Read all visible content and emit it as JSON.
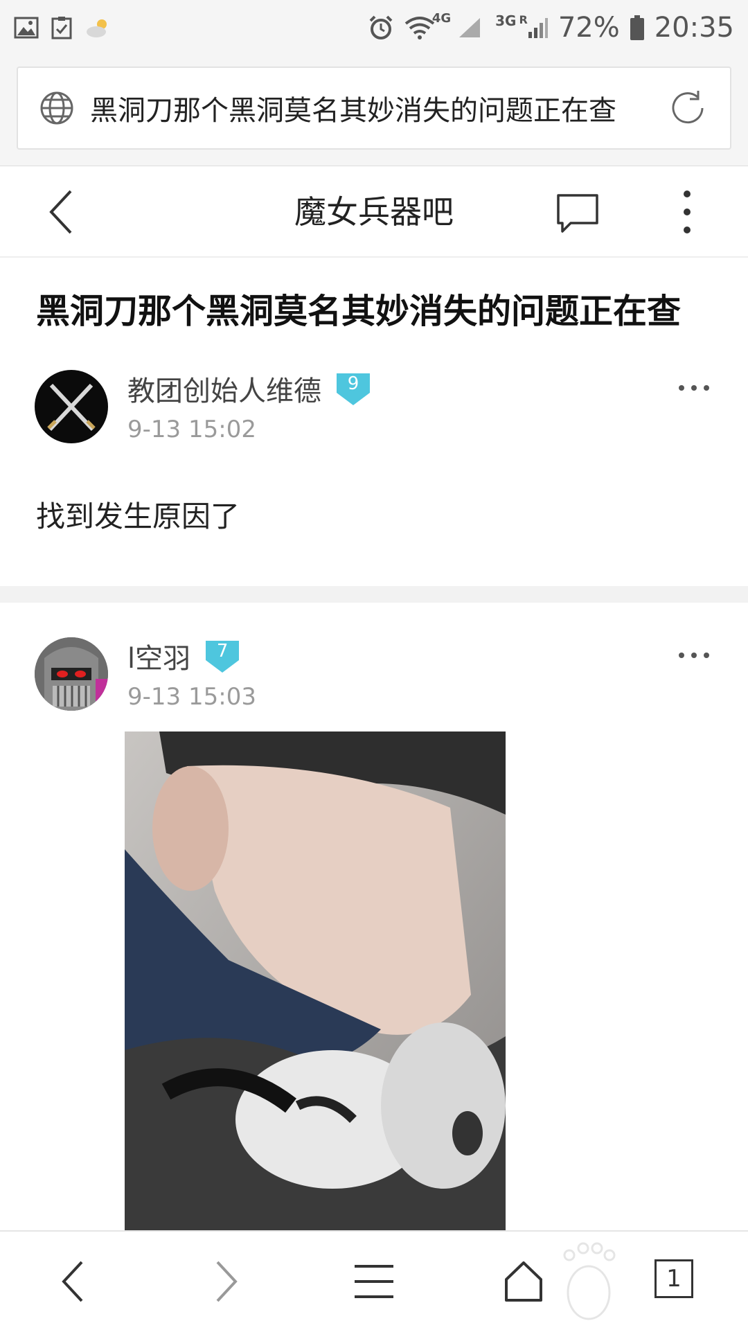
{
  "status_bar": {
    "battery_percent": "72%",
    "time": "20:35",
    "network_1": "4G",
    "network_2": "3G",
    "roaming": "R",
    "icons": [
      "image-icon",
      "task-icon",
      "weather-icon",
      "alarm-icon",
      "wifi-icon",
      "signal-icon",
      "battery-icon"
    ]
  },
  "url_bar": {
    "text": "黑洞刀那个黑洞莫名其妙消失的问题正在查",
    "icons": [
      "globe-icon",
      "refresh-icon"
    ]
  },
  "header": {
    "title": "魔女兵器吧",
    "icons": [
      "back-icon",
      "comment-icon",
      "more-vertical-icon"
    ]
  },
  "post": {
    "title": "黑洞刀那个黑洞莫名其妙消失的问题正在查"
  },
  "floors": [
    {
      "username": "教团创始人维德",
      "level": "9",
      "time": "9-13 15:02",
      "content": "找到发生原因了"
    },
    {
      "username": "l空羽",
      "level": "7",
      "time": "9-13 15:03"
    }
  ],
  "toolbar": {
    "tab_count": "1",
    "icons": [
      "back-arrow-icon",
      "forward-arrow-icon",
      "menu-icon",
      "home-icon",
      "tabs-icon"
    ]
  },
  "colors": {
    "level_badge": "#4ec6de",
    "accent_text": "#222222",
    "muted_text": "#9a9a9a"
  }
}
